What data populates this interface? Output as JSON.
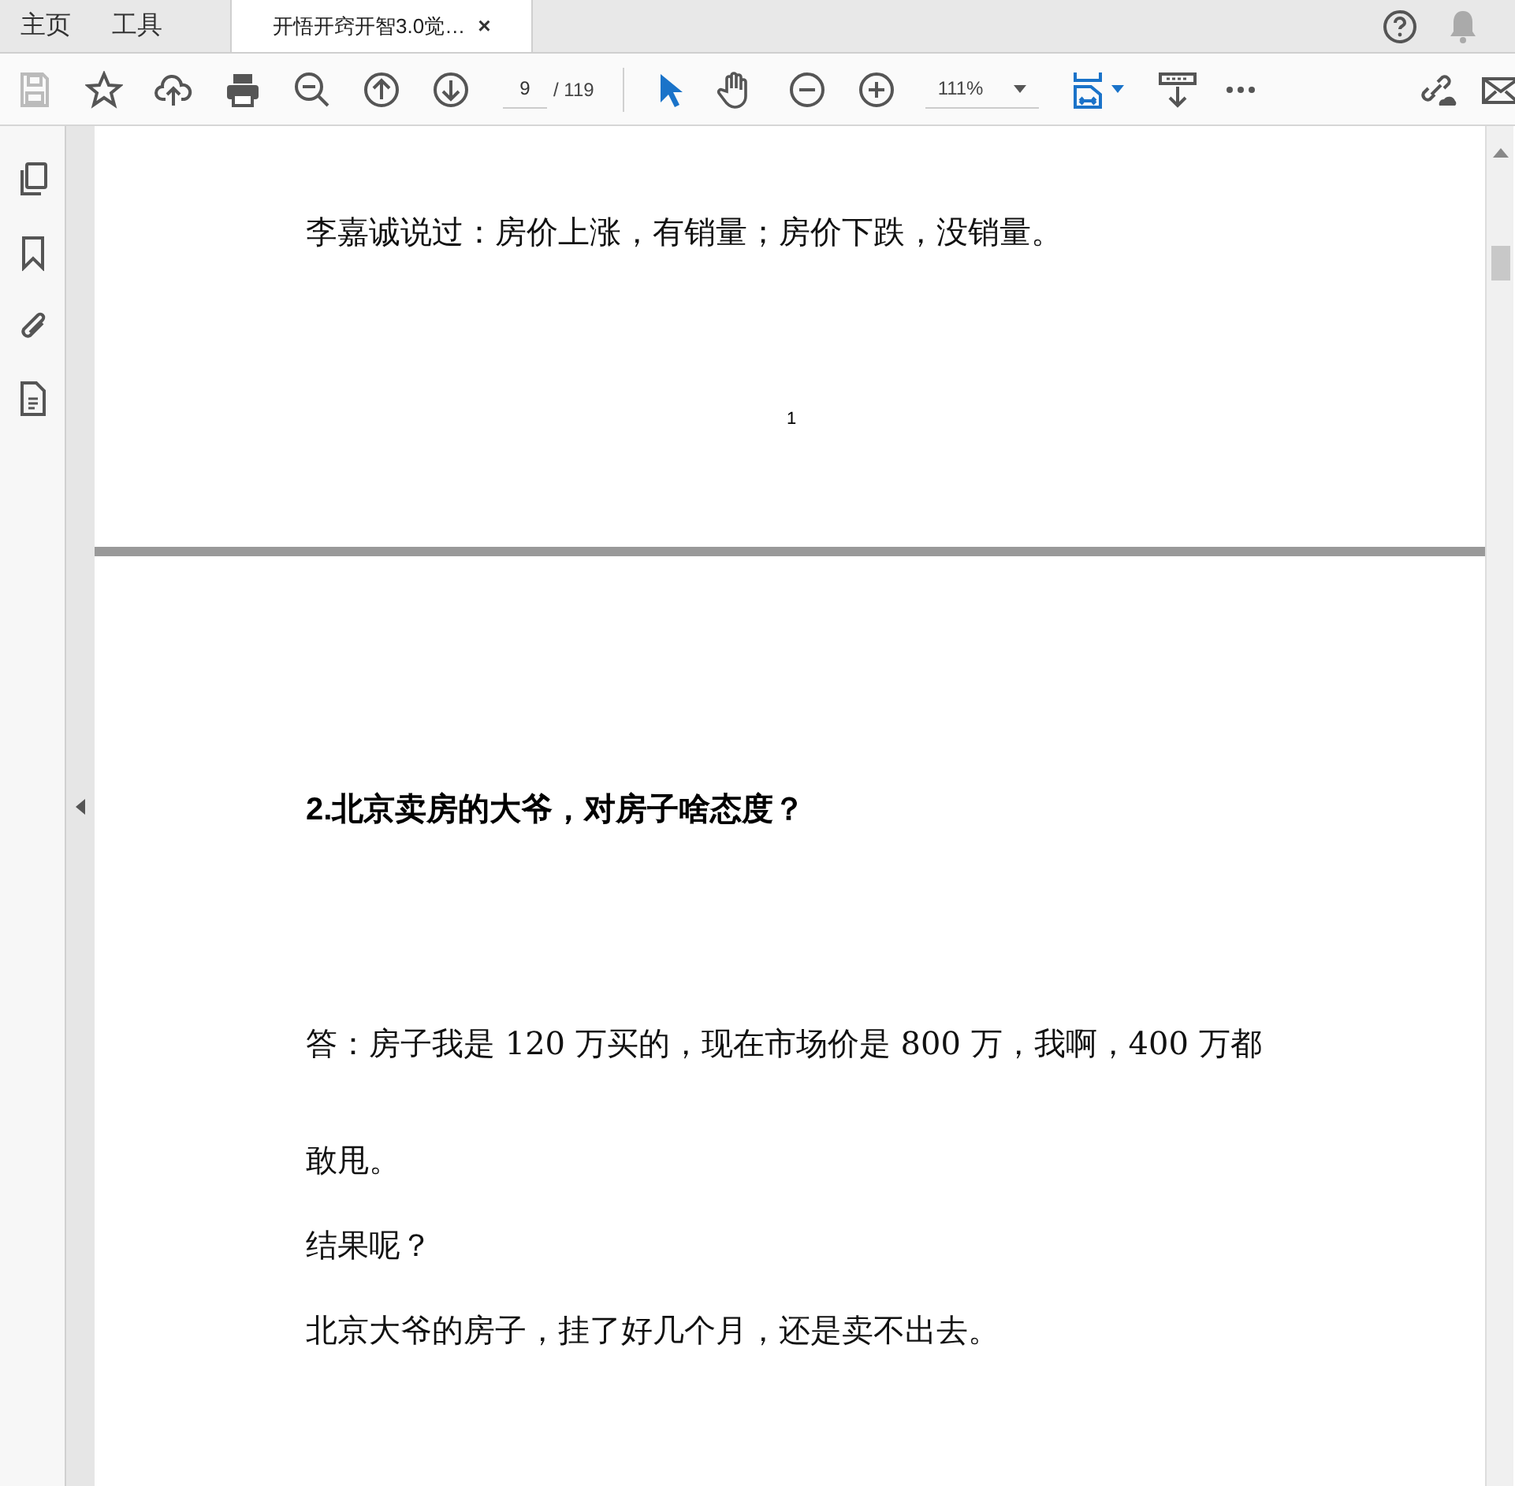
{
  "tabs": [
    {
      "label": "主页",
      "selected": false
    },
    {
      "label": "工具",
      "selected": false
    },
    {
      "label": "开悟开窍开智3.0觉…",
      "selected": true,
      "close": "×"
    }
  ],
  "toolbar": {
    "page_number": "9",
    "page_total": "/ 119",
    "zoom": "111%",
    "tools": [
      {
        "kind": "select",
        "selected": true
      },
      {
        "kind": "hand",
        "selected": false
      }
    ]
  },
  "pages": [
    {
      "paragraphs": [
        "李嘉诚说过：房价上涨，有销量；房价下跌，没销量。"
      ],
      "page_number": "1"
    },
    {
      "heading": "2.北京卖房的大爷，对房子啥态度？",
      "paragraphs": [
        "答：房子我是 120 万买的，现在市场价是 800 万，我啊，400 万都敢甩。",
        "结果呢？",
        "北京大爷的房子，挂了好几个月，还是卖不出去。"
      ]
    }
  ]
}
